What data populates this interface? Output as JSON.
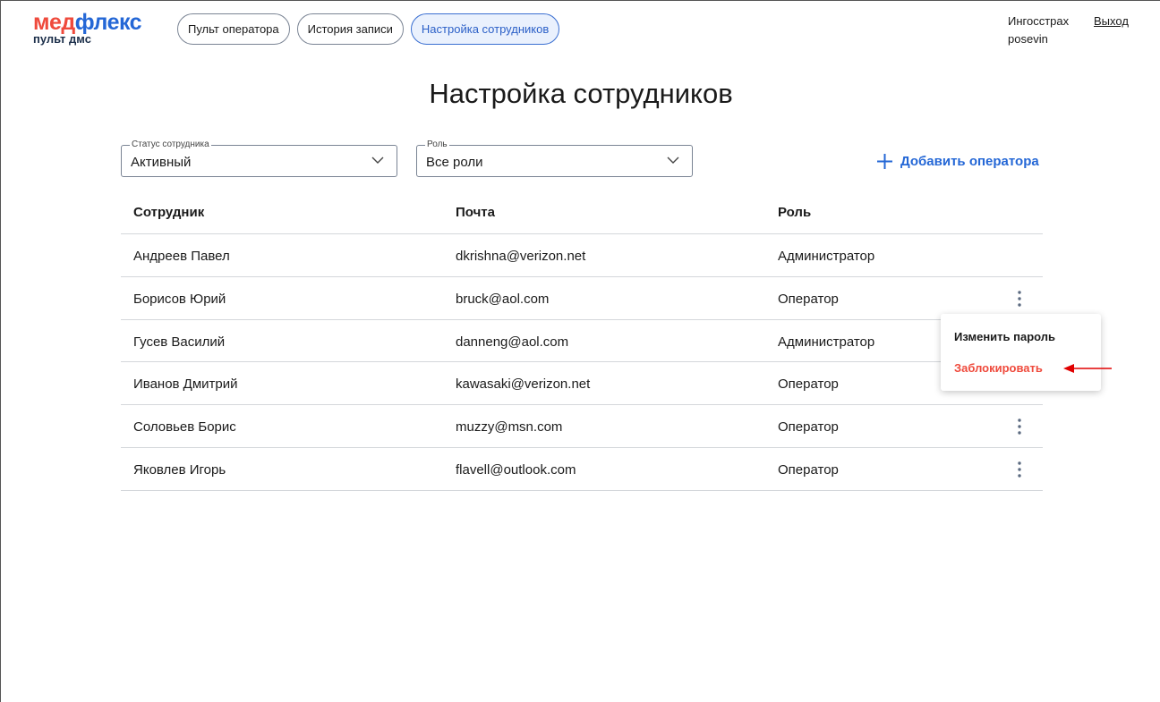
{
  "brand": {
    "logo_part1": "мед",
    "logo_part2": "флекс",
    "logo_sub": "пульт дмс",
    "colors": {
      "red": "#ef4a3c",
      "blue": "#2467d6"
    }
  },
  "nav": [
    {
      "label": "Пульт оператора",
      "active": false
    },
    {
      "label": "История записи",
      "active": false
    },
    {
      "label": "Настройка сотрудников",
      "active": true
    }
  ],
  "user": {
    "company": "Ингосстрах",
    "login": "posevin",
    "logout_label": "Выход"
  },
  "page_title": "Настройка сотрудников",
  "filters": {
    "status": {
      "legend": "Статус сотрудника",
      "value": "Активный"
    },
    "role": {
      "legend": "Роль",
      "value": "Все роли"
    }
  },
  "add_operator_label": "Добавить оператора",
  "table": {
    "headers": [
      "Сотрудник",
      "Почта",
      "Роль"
    ],
    "rows": [
      {
        "name": "Андреев Павел",
        "email": "dkrishna@verizon.net",
        "role": "Администратор",
        "menu": false
      },
      {
        "name": "Борисов Юрий",
        "email": "bruck@aol.com",
        "role": "Оператор",
        "menu": true
      },
      {
        "name": "Гусев Василий",
        "email": "danneng@aol.com",
        "role": "Администратор",
        "menu": false
      },
      {
        "name": "Иванов Дмитрий",
        "email": "kawasaki@verizon.net",
        "role": "Оператор",
        "menu": false
      },
      {
        "name": "Соловьев Борис",
        "email": "muzzy@msn.com",
        "role": "Оператор",
        "menu": true
      },
      {
        "name": "Яковлев Игорь",
        "email": "flavell@outlook.com",
        "role": "Оператор",
        "menu": true
      }
    ]
  },
  "context_menu": {
    "change_password": "Изменить пароль",
    "block": "Заблокировать"
  }
}
